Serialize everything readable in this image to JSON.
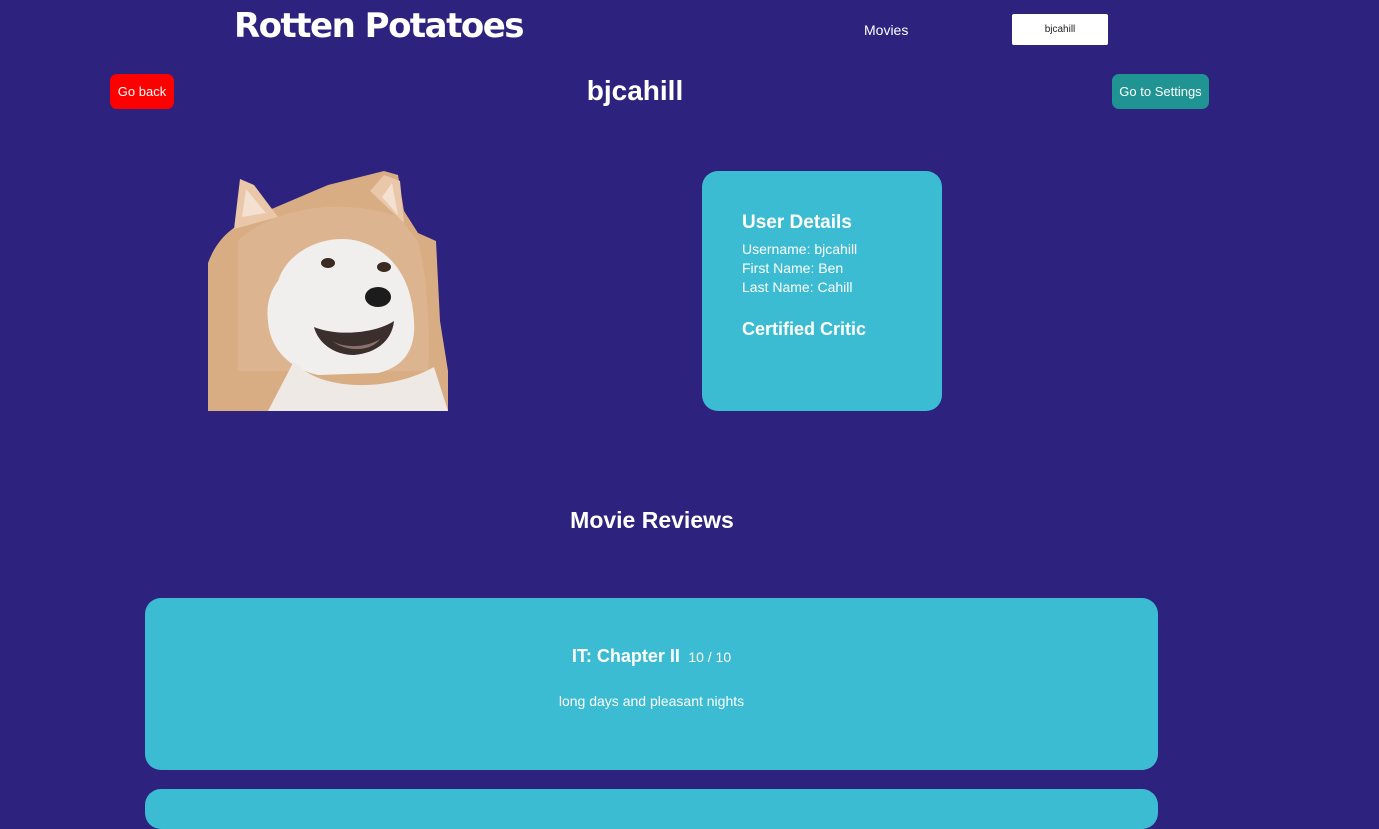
{
  "header": {
    "logo": "Rotten Potatoes",
    "nav_movies": "Movies",
    "nav_user": "bjcahill"
  },
  "actions": {
    "back_label": "Go back",
    "settings_label": "Go to Settings"
  },
  "profile": {
    "title": "bjcahill",
    "avatar_alt": "shiba inu dog profile picture"
  },
  "details": {
    "heading": "User Details",
    "username": "Username: bjcahill",
    "first_name": "First Name: Ben",
    "last_name": "Last Name: Cahill",
    "badge": "Certified Critic"
  },
  "reviews": {
    "heading": "Movie Reviews",
    "items": [
      {
        "movie": "IT: Chapter II",
        "score": "10 / 10",
        "text": "long days and pleasant nights"
      }
    ]
  },
  "colors": {
    "background": "#2d237e",
    "card": "#3bbcd3",
    "back_button": "#ff0000",
    "settings_button": "#1f9492"
  }
}
